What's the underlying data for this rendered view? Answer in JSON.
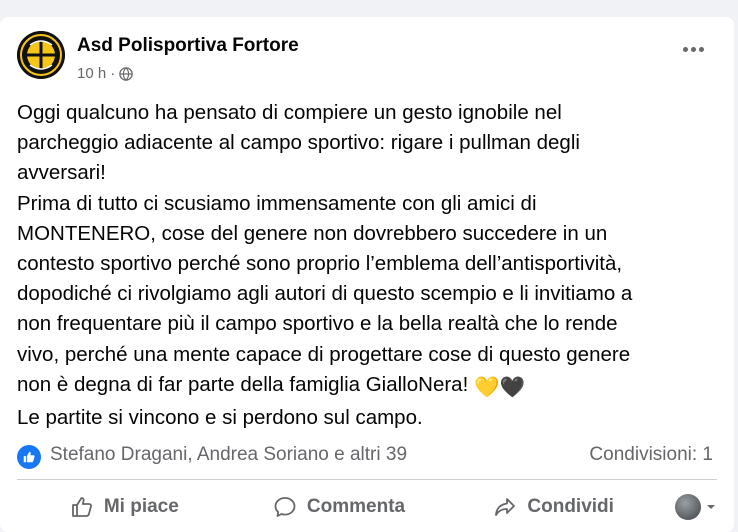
{
  "post": {
    "page_name": "Asd Polisportiva Fortore",
    "time": "10 h",
    "separator": "·",
    "avatar_icon": "polisportiva-fortore-logo",
    "audience_icon": "globe-icon",
    "lines": [
      "Oggi qualcuno ha pensato di compiere un gesto ignobile nel\nparcheggio adiacente al campo sportivo: rigare i pullman degli\navversari!",
      "Prima di tutto ci scusiamo immensamente con gli amici di\nMONTENERO, cose del genere non dovrebbero succedere in un\ncontesto sportivo perché sono proprio l’emblema dell’antisportività,\ndopodiché ci rivolgiamo agli autori di questo scempio e li invitiamo a\nnon frequentare più il campo sportivo e la bella realtà che lo rende\nvivo, perché una mente capace di progettare cose di questo genere\nnon è degna di far parte della famiglia GialloNera! ",
      "Le partite si vincono e si perdono sul campo."
    ],
    "emoji": "💛🖤"
  },
  "stats": {
    "reactors": "Stefano Dragani, Andrea Soriano e altri 39",
    "shares": "Condivisioni: 1"
  },
  "actions": {
    "like": "Mi piace",
    "comment": "Commenta",
    "share": "Condividi"
  },
  "colors": {
    "accent": "#1877f2",
    "secondary_text": "#65676b",
    "gold": "#f5c518"
  }
}
